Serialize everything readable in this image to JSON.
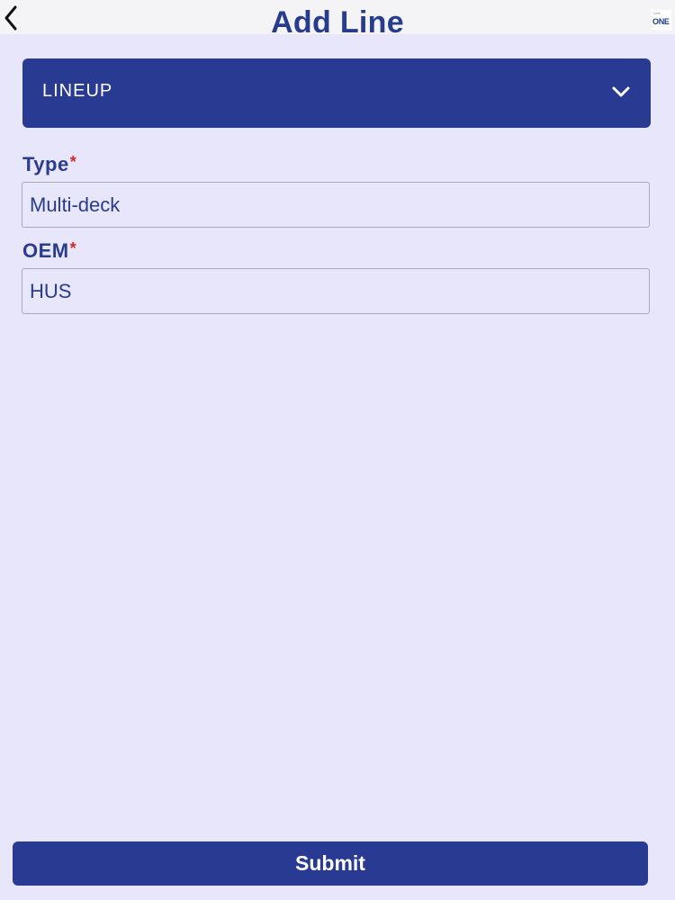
{
  "header": {
    "title": "Add Line",
    "back_icon": "chevron-left-icon",
    "logo": {
      "small_text": "Line",
      "text": "ONE"
    }
  },
  "lineup": {
    "label": "LINEUP",
    "icon": "chevron-down-icon"
  },
  "form": {
    "type": {
      "label": "Type",
      "required_mark": "*",
      "value": "Multi-deck"
    },
    "oem": {
      "label": "OEM",
      "required_mark": "*",
      "value": "HUS"
    }
  },
  "footer": {
    "submit_label": "Submit"
  },
  "colors": {
    "background": "#e8e6fa",
    "header_bg": "#f4f3f5",
    "primary": "#283a92",
    "title_text": "#283c8e",
    "required": "#d9262b",
    "field_border": "#a9a9b6"
  }
}
